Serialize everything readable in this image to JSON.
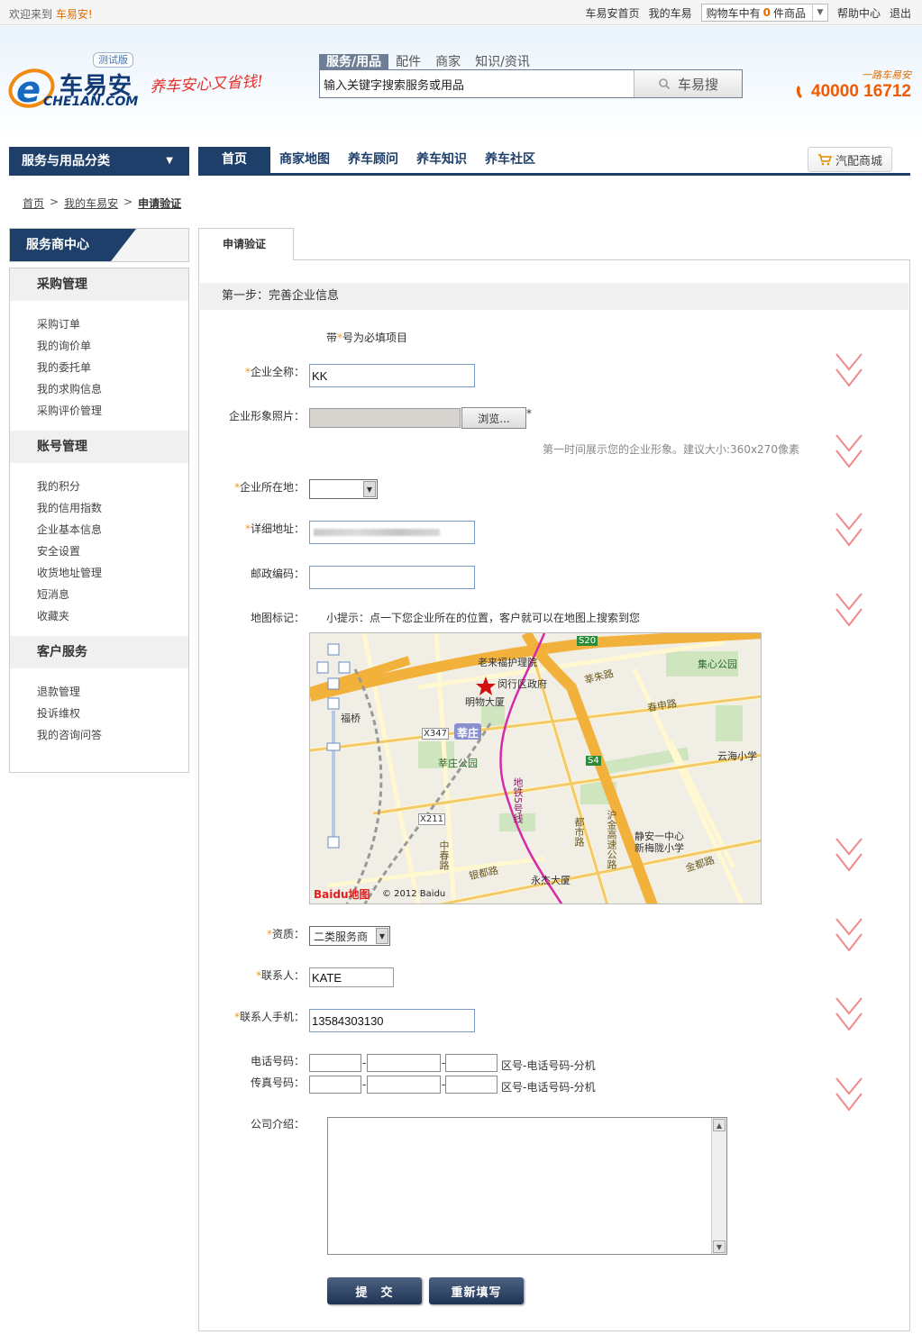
{
  "topbar": {
    "welcome_prefix": "欢迎来到",
    "welcome_brand": "车易安!",
    "home": "车易安首页",
    "my_cheyi": "我的车易",
    "cart_prefix": "购物车中有",
    "cart_count": "0",
    "cart_suffix": "件商品",
    "help": "帮助中心",
    "logout": "退出"
  },
  "header": {
    "logo_cn": "车易安",
    "logo_en": "CHE1AN.COM",
    "beta": "测试版",
    "slogan": "养车安心又省钱!",
    "search_tabs": [
      "服务/用品",
      "配件",
      "商家",
      "知识/资讯"
    ],
    "search_placeholder": "输入关键字搜索服务或用品",
    "search_button": "车易搜",
    "hotline_caption": "一路车易安",
    "hotline": "40000 16712"
  },
  "nav": {
    "category": "服务与用品分类",
    "items": [
      "首页",
      "商家地图",
      "养车顾问",
      "养车知识",
      "养车社区"
    ],
    "mall": "汽配商城"
  },
  "breadcrumb": [
    "首页",
    "我的车易安",
    "申请验证"
  ],
  "sidebar": {
    "title": "服务商中心",
    "sections": [
      {
        "title": "采购管理",
        "items": [
          "采购订单",
          "我的询价单",
          "我的委托单",
          "我的求购信息",
          "采购评价管理"
        ]
      },
      {
        "title": "账号管理",
        "items": [
          "我的积分",
          "我的信用指数",
          "企业基本信息",
          "安全设置",
          "收货地址管理",
          "短消息",
          "收藏夹"
        ]
      },
      {
        "title": "客户服务",
        "items": [
          "退款管理",
          "投诉维权",
          "我的咨询问答"
        ]
      }
    ]
  },
  "form": {
    "tab": "申请验证",
    "step": "第一步：完善企业信息",
    "required_note_prefix": "带",
    "required_note_suffix": "号为必填项目",
    "company_name_label": "企业全称：",
    "company_name_value": "KK",
    "photo_label": "企业形象照片：",
    "browse_button": "浏览...",
    "photo_hint": "第一时间展示您的企业形象。建议大小:360x270像素",
    "location_label": "企业所在地：",
    "address_label": "详细地址：",
    "postcode_label": "邮政编码：",
    "map_label": "地图标记：",
    "map_tip": "小提示：点一下您企业所在的位置，客户就可以在地图上搜索到您",
    "qualification_label": "资质：",
    "qualification_value": "二类服务商",
    "contact_label": "联系人：",
    "contact_value": "KATE",
    "mobile_label": "联系人手机：",
    "mobile_value": "13584303130",
    "phone_label": "电话号码：",
    "fax_label": "传真号码：",
    "phone_format": "区号-电话号码-分机",
    "intro_label": "公司介绍：",
    "submit": "提　交",
    "reset": "重新填写"
  },
  "map": {
    "labels": [
      "老来福护理院",
      "闵行区政府",
      "明物大厦",
      "莘庄",
      "莘庄公园",
      "集心公园",
      "云海小学",
      "静安一中心",
      "新梅陇小学",
      "永杰大厦",
      "莘朱路",
      "春申路",
      "沪金高速公路",
      "都市路",
      "银都路",
      "金都路",
      "中春路",
      "地铁5号线",
      "福桥",
      "S20",
      "S4",
      "X347",
      "X211"
    ],
    "brand": "Baidu地图",
    "copyright": "© 2012 Baidu"
  },
  "colors": {
    "nav_blue": "#1d3f6a",
    "orange": "#f05a00",
    "required": "#f09a1a",
    "chevron": "#f08a8a"
  }
}
